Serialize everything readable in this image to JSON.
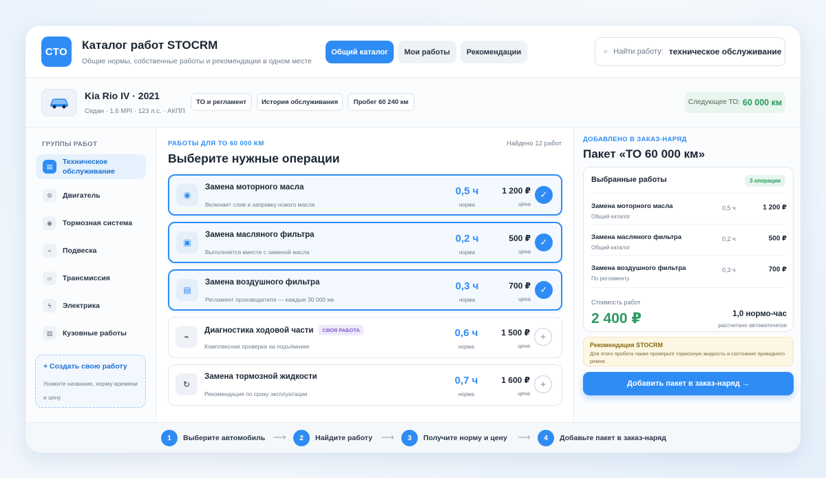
{
  "header": {
    "logo": "СТО",
    "title": "Каталог работ STOCRM",
    "subtitle": "Общие нормы, собственные работы и рекомендации в одном месте",
    "tabs": [
      {
        "label": "Общий каталог",
        "active": true
      },
      {
        "label": "Мои работы",
        "active": false
      },
      {
        "label": "Рекомендации",
        "active": false
      }
    ],
    "search": {
      "label": "Найти работу:",
      "value": "техническое обслуживание"
    }
  },
  "car": {
    "title": "Kia Rio IV · 2021",
    "subtitle": "Седан · 1.6 MPI · 123 л.с. · АКПП",
    "chips": [
      "ТО и регламент",
      "История обслуживания",
      "Пробег 60 240 км"
    ],
    "next_to_label": "Следующее ТО:",
    "next_to_value": "60 000 км"
  },
  "sidebar": {
    "heading": "ГРУППЫ РАБОТ",
    "items": [
      {
        "label": "Техническое обслуживание",
        "icon": "▤",
        "active": true
      },
      {
        "label": "Двигатель",
        "icon": "⚙",
        "active": false
      },
      {
        "label": "Тормозная система",
        "icon": "◉",
        "active": false
      },
      {
        "label": "Подвеска",
        "icon": "⌁",
        "active": false
      },
      {
        "label": "Трансмиссия",
        "icon": "▱",
        "active": false
      },
      {
        "label": "Электрика",
        "icon": "ϟ",
        "active": false
      },
      {
        "label": "Кузовные работы",
        "icon": "▧",
        "active": false
      }
    ],
    "create": {
      "title": "+ Создать свою работу",
      "subtitle": "Укажите название, норму времени и цену"
    }
  },
  "main": {
    "eyebrow": "РАБОТЫ ДЛЯ ТО 60 000 КМ",
    "found": "Найдено 12 работ",
    "title": "Выберите нужные операции",
    "hours_label": "норма",
    "price_label": "цена",
    "operations": [
      {
        "title": "Замена моторного масла",
        "desc": "Включает слив и заправку нового масла",
        "hours": "0,5 ч",
        "price": "1 200 ₽",
        "selected": true,
        "icon": "◉",
        "badge": ""
      },
      {
        "title": "Замена масляного фильтра",
        "desc": "Выполняется вместе с заменой масла",
        "hours": "0,2 ч",
        "price": "500 ₽",
        "selected": true,
        "icon": "▣",
        "badge": ""
      },
      {
        "title": "Замена воздушного фильтра",
        "desc": "Регламент производителя — каждые 30 000 км",
        "hours": "0,3 ч",
        "price": "700 ₽",
        "selected": true,
        "icon": "▤",
        "badge": ""
      },
      {
        "title": "Диагностика ходовой части",
        "desc": "Комплексная проверка на подъёмнике",
        "hours": "0,6 ч",
        "price": "1 500 ₽",
        "selected": false,
        "icon": "⌁",
        "badge": "СВОЯ РАБОТА"
      },
      {
        "title": "Замена тормозной жидкости",
        "desc": "Рекомендация по сроку эксплуатации",
        "hours": "0,7 ч",
        "price": "1 600 ₽",
        "selected": false,
        "icon": "↻",
        "badge": ""
      }
    ]
  },
  "order": {
    "eyebrow": "ДОБАВЛЕНО В ЗАКАЗ-НАРЯД",
    "title": "Пакет «ТО 60 000 км»",
    "card_heading": "Выбранные работы",
    "count": "3 операции",
    "works": [
      {
        "name": "Замена моторного масла",
        "source": "Общий каталог",
        "hours": "0,5 ч",
        "price": "1 200 ₽"
      },
      {
        "name": "Замена масляного фильтра",
        "source": "Общий каталог",
        "hours": "0,2 ч",
        "price": "500 ₽"
      },
      {
        "name": "Замена воздушного фильтра",
        "source": "По регламенту",
        "hours": "0,3 ч",
        "price": "700 ₽"
      }
    ],
    "total_label": "Стоимость работ",
    "total": "2 400 ₽",
    "norm": "1,0 нормо-час",
    "auto": "рассчитано автоматически",
    "reco_title": "Рекомендация STOCRM",
    "reco_text": "Для этого пробега также проверьте тормозную жидкость и состояние приводного ремня.",
    "button": "Добавить пакет в заказ-наряд →"
  },
  "steps": [
    {
      "num": "1",
      "label": "Выберите автомобиль"
    },
    {
      "num": "2",
      "label": "Найдите работу"
    },
    {
      "num": "3",
      "label": "Получите норму и цену"
    },
    {
      "num": "4",
      "label": "Добавьте пакет в заказ-наряд"
    }
  ],
  "colors": {
    "accent": "#2f8cf4",
    "success": "#2b9a5e"
  }
}
